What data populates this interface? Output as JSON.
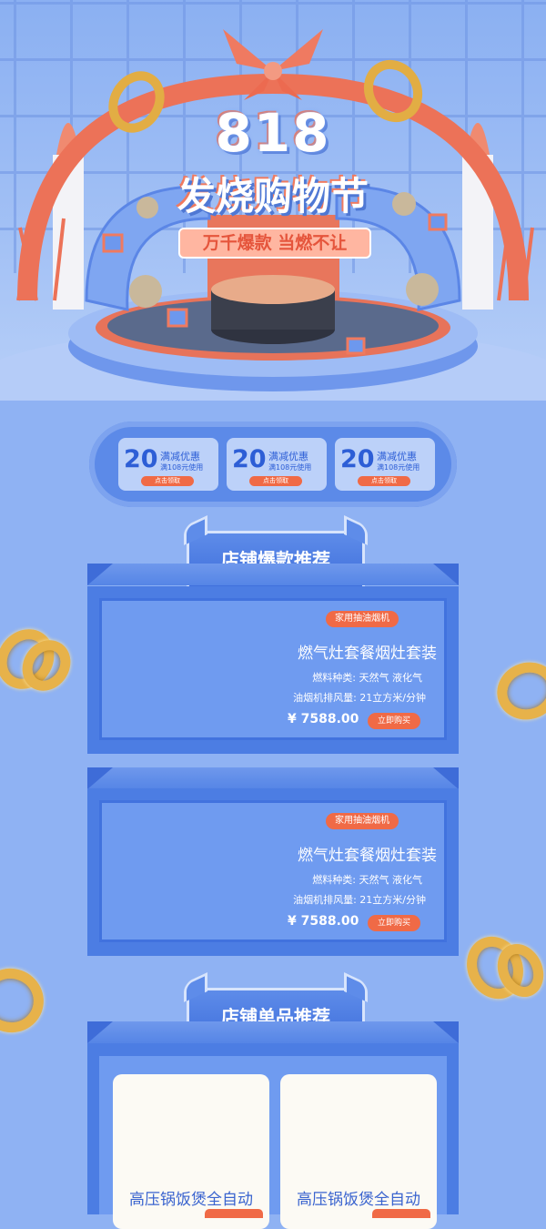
{
  "hero": {
    "title_number": "818",
    "title_text": "发烧购物节",
    "slogan": "万千爆款 当燃不让"
  },
  "coupons": [
    {
      "amount": "20",
      "label": "满减优惠",
      "condition": "满108元使用",
      "button": "点击领取"
    },
    {
      "amount": "20",
      "label": "满减优惠",
      "condition": "满108元使用",
      "button": "点击领取"
    },
    {
      "amount": "20",
      "label": "满减优惠",
      "condition": "满108元使用",
      "button": "点击领取"
    }
  ],
  "hot_section": {
    "title": "店铺爆款推荐",
    "products": [
      {
        "tag": "家用抽油烟机",
        "name": "燃气灶套餐烟灶套装",
        "spec1": "燃料种类: 天然气 液化气",
        "spec2": "油烟机排风量: 21立方米/分钟",
        "price": "¥ 7588.00",
        "buy": "立即购买"
      },
      {
        "tag": "家用抽油烟机",
        "name": "燃气灶套餐烟灶套装",
        "spec1": "燃料种类: 天然气 液化气",
        "spec2": "油烟机排风量: 21立方米/分钟",
        "price": "¥ 7588.00",
        "buy": "立即购买"
      }
    ]
  },
  "single_section": {
    "title": "店铺单品推荐",
    "items": [
      {
        "name": "高压锅饭煲全自动"
      },
      {
        "name": "高压锅饭煲全自动"
      }
    ]
  },
  "colors": {
    "background": "#8fb2f3",
    "primary_blue": "#4c7de3",
    "accent_orange": "#f06a46",
    "gold": "#e7b24a"
  }
}
